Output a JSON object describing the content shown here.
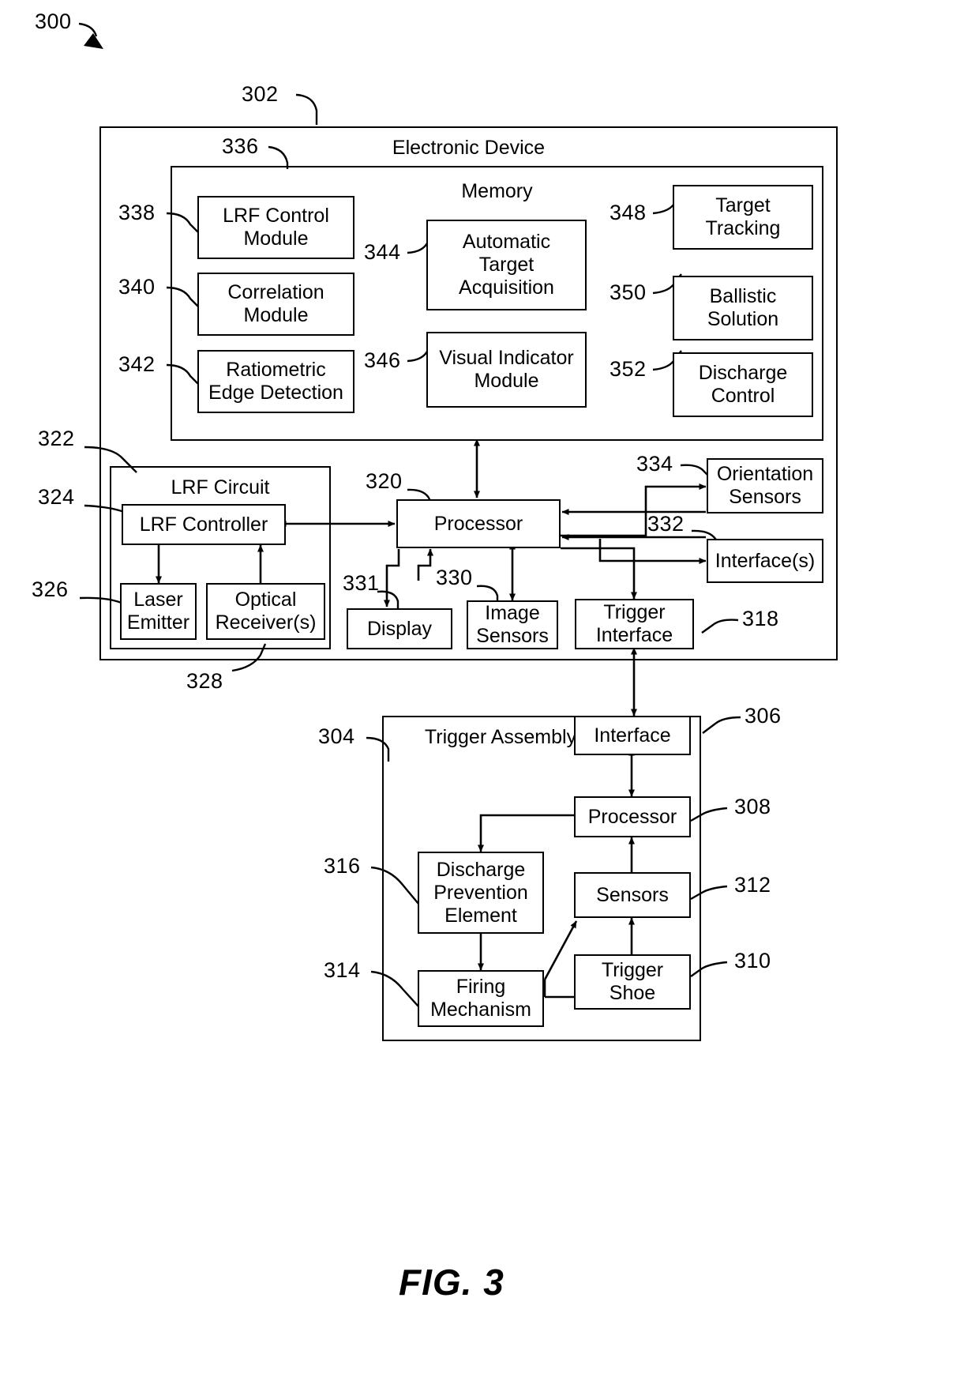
{
  "figure": {
    "caption": "FIG. 3",
    "top_ref": "300"
  },
  "electronic_device": {
    "title": "Electronic Device",
    "ref": "302",
    "memory": {
      "title": "Memory",
      "ref": "336",
      "left_modules": [
        {
          "ref": "338",
          "label": "LRF Control\nModule"
        },
        {
          "ref": "340",
          "label": "Correlation\nModule"
        },
        {
          "ref": "342",
          "label": "Ratiometric\nEdge Detection"
        }
      ],
      "center_modules": [
        {
          "ref": "344",
          "label": "Automatic\nTarget\nAcquisition"
        },
        {
          "ref": "346",
          "label": "Visual Indicator\nModule"
        }
      ],
      "right_modules": [
        {
          "ref": "348",
          "label": "Target\nTracking"
        },
        {
          "ref": "350",
          "label": "Ballistic\nSolution"
        },
        {
          "ref": "352",
          "label": "Discharge\nControl"
        }
      ]
    },
    "lrf_circuit": {
      "title": "LRF Circuit",
      "ref": "322",
      "controller": {
        "ref": "324",
        "label": "LRF Controller"
      },
      "laser_emitter": {
        "ref": "326",
        "label": "Laser\nEmitter"
      },
      "optical_receiver": {
        "ref": "328",
        "label": "Optical\nReceiver(s)"
      }
    },
    "processor": {
      "ref": "320",
      "label": "Processor"
    },
    "display": {
      "ref": "331",
      "label": "Display"
    },
    "image_sensors": {
      "ref": "330",
      "label": "Image\nSensors"
    },
    "trigger_interface": {
      "ref": "318",
      "label": "Trigger\nInterface"
    },
    "orientation_sensors": {
      "ref": "334",
      "label": "Orientation\nSensors"
    },
    "interfaces": {
      "ref": "332",
      "label": "Interface(s)"
    }
  },
  "trigger_assembly": {
    "title": "Trigger Assembly",
    "ref": "304",
    "interface": {
      "ref": "306",
      "label": "Interface"
    },
    "processor": {
      "ref": "308",
      "label": "Processor"
    },
    "sensors": {
      "ref": "312",
      "label": "Sensors"
    },
    "trigger_shoe": {
      "ref": "310",
      "label": "Trigger\nShoe"
    },
    "discharge_prevention": {
      "ref": "316",
      "label": "Discharge\nPrevention\nElement"
    },
    "firing_mechanism": {
      "ref": "314",
      "label": "Firing\nMechanism"
    }
  },
  "colors": {
    "line": "#000000",
    "background": "#ffffff"
  }
}
